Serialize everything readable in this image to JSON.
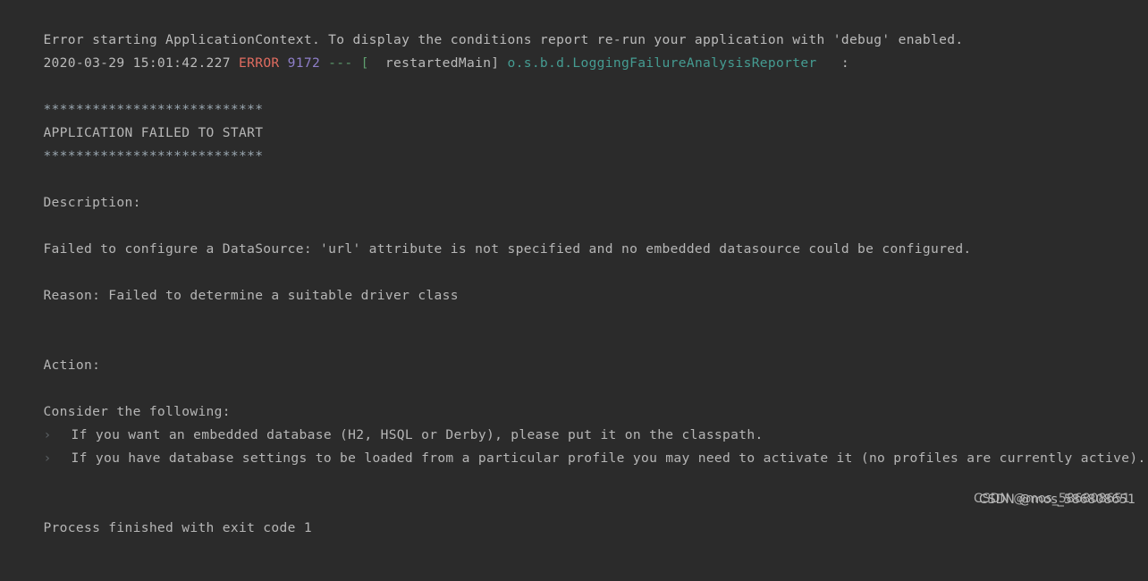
{
  "console": {
    "background_color": "#2b2b2b",
    "default_text_color": "#bbbbbb",
    "lines": [
      {
        "text": "Error starting ApplicationContext. To display the conditions report re-run your application with 'debug' enabled."
      },
      {
        "text": "2020-03-29 15:01:42.227 "
      },
      {
        "text": ""
      },
      {
        "text": "***************************"
      },
      {
        "text": "APPLICATION FAILED TO START"
      },
      {
        "text": "***************************"
      },
      {
        "text": ""
      },
      {
        "text": "Description:"
      },
      {
        "text": ""
      },
      {
        "text": "Failed to configure a DataSource: 'url' attribute is not specified and no embedded datasource could be configured."
      },
      {
        "text": ""
      },
      {
        "text": "Reason: Failed to determine a suitable driver class"
      },
      {
        "text": ""
      },
      {
        "text": ""
      },
      {
        "text": "Action:"
      },
      {
        "text": ""
      },
      {
        "text": "Consider the following:"
      },
      {
        "text": ""
      },
      {
        "text": ""
      },
      {
        "text": "Process finished with exit code 1"
      }
    ],
    "log_line": {
      "timestamp": "2020-03-29 15:01:42.227 ",
      "level": "ERROR",
      "pid": " 9172",
      "separator": " --- ",
      "bracket_open": "[",
      "thread": "  restartedMain]",
      "logger": " o.s.b.d.LoggingFailureAnalysisReporter",
      "colon": "   :",
      "colors": {
        "level": "#e06c60",
        "pid": "#8f7fc9",
        "separator": "#5e9e6e",
        "bracket": "#5e9e6e",
        "thread": "#bbbbbb",
        "logger": "#459c92"
      }
    },
    "banner": {
      "top_stars": "***************************",
      "title": "APPLICATION FAILED TO START",
      "bottom_stars": "***************************"
    },
    "description_label": "Description:",
    "description_text": "Failed to configure a DataSource: 'url' attribute is not specified and no embedded datasource could be configured.",
    "reason_text": "Reason: Failed to determine a suitable driver class",
    "action_label": "Action:",
    "consider_label": "Consider the following:",
    "bullets": [
      {
        "marker": "›",
        "text": "If you want an embedded database (H2, HSQL or Derby), please put it on the classpath."
      },
      {
        "marker": "›",
        "text": "If you have database settings to be loaded from a particular profile you may need to activate it (no profiles are currently active)."
      }
    ],
    "exit_line": "Process finished with exit code 1"
  },
  "watermark": {
    "text_front": "CSDN @mos_586808651",
    "text_back": "CSDN @mos_586808651"
  }
}
